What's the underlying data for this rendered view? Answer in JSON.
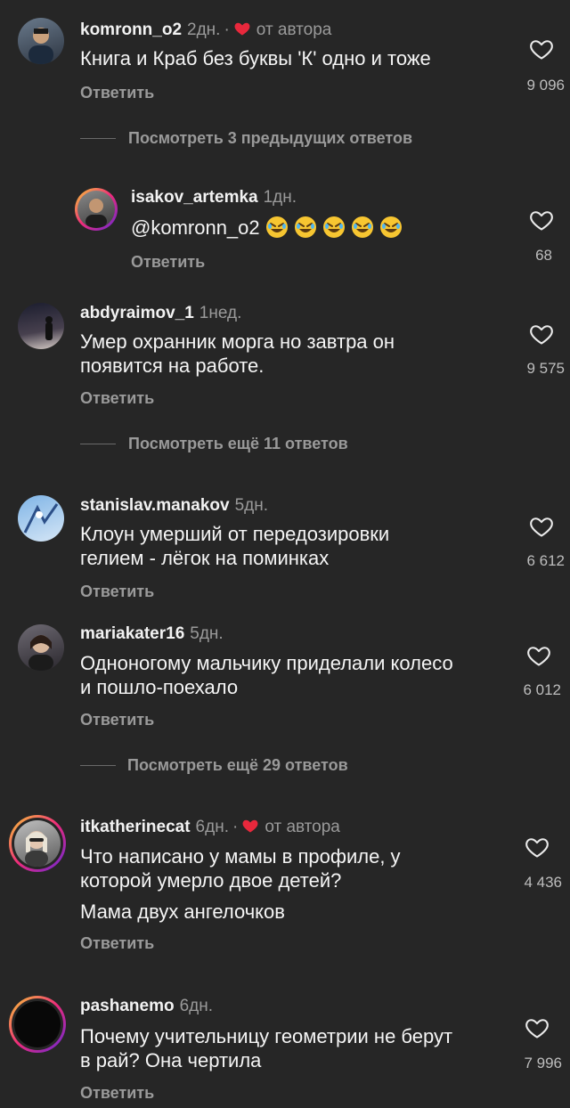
{
  "comments": [
    {
      "user": "komronn_o2",
      "time": "2дн.",
      "author_note": "от автора",
      "text": "Книга и Краб без буквы 'К' одно и тоже",
      "reply": "Ответить",
      "likes": "9 096"
    },
    {
      "user": "isakov_artemka",
      "time": "1дн.",
      "text": "@komronn_o2",
      "reply": "Ответить",
      "likes": "68"
    },
    {
      "user": "abdyraimov_1",
      "time": "1нед.",
      "text1": "Умер охранник морга но завтра он",
      "text2": "появится на работе.",
      "reply": "Ответить",
      "likes": "9 575"
    },
    {
      "user": "stanislav.manakov",
      "time": "5дн.",
      "text1": "Клоун умерший от передозировки",
      "text2": "гелием - лёгок на поминках",
      "reply": "Ответить",
      "likes": "6 612"
    },
    {
      "user": "mariakater16",
      "time": "5дн.",
      "text1": "Одноногому мальчику приделали колесо",
      "text2": "и пошло-поехало",
      "reply": "Ответить",
      "likes": "6 012"
    },
    {
      "user": "itkatherinecat",
      "time": "6дн.",
      "author_note": "от автора",
      "text1": "Что написано у мамы в профиле, у",
      "text2": "которой умерло двое детей?",
      "text3": "Мама двух ангелочков",
      "reply": "Ответить",
      "likes": "4 436"
    },
    {
      "user": "pashanemo",
      "time": "6дн.",
      "text1": "Почему учительницу геометрии не берут",
      "text2": "в рай? Она чертила",
      "reply": "Ответить",
      "likes": "7 996"
    }
  ],
  "view_more": [
    "Посмотреть 3 предыдущих ответов",
    "Посмотреть ещё 11 ответов",
    "Посмотреть ещё 29 ответов"
  ],
  "colors": {
    "background": "#262626",
    "heart_red": "#e8283c",
    "muted": "#9a9a9a"
  },
  "icons": {
    "like": "heart-outline-icon",
    "author_like": "heart-filled-icon",
    "emoji": "rofl-emoji-icon"
  }
}
